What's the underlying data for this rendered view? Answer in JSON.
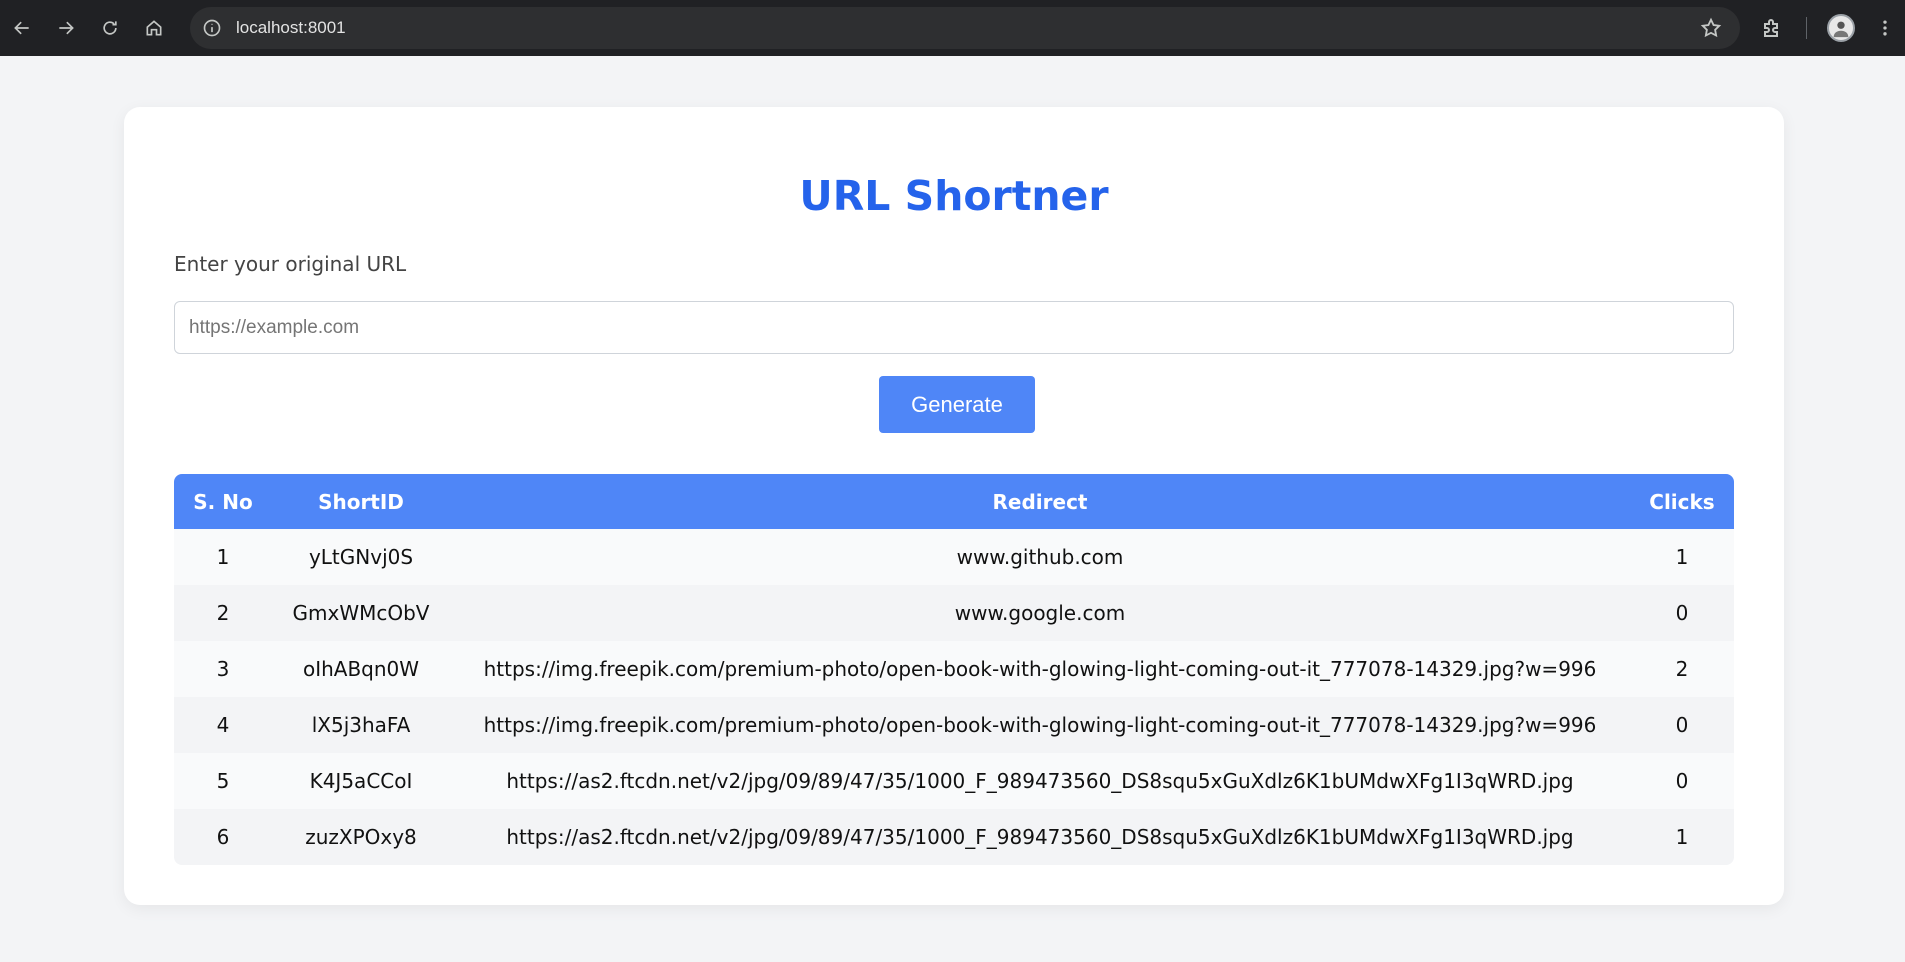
{
  "browser": {
    "url": "localhost:8001"
  },
  "app": {
    "title": "URL Shortner",
    "input_label": "Enter your original URL",
    "input_placeholder": "https://example.com",
    "input_value": "",
    "generate_label": "Generate",
    "accent_color": "#2563eb",
    "button_color": "#4f86f7"
  },
  "table": {
    "headers": [
      "S. No",
      "ShortID",
      "Redirect",
      "Clicks"
    ],
    "rows": [
      {
        "sno": "1",
        "shortid": "yLtGNvj0S",
        "redirect": "www.github.com",
        "clicks": "1"
      },
      {
        "sno": "2",
        "shortid": "GmxWMcObV",
        "redirect": "www.google.com",
        "clicks": "0"
      },
      {
        "sno": "3",
        "shortid": "oIhABqn0W",
        "redirect": "https://img.freepik.com/premium-photo/open-book-with-glowing-light-coming-out-it_777078-14329.jpg?w=996",
        "clicks": "2"
      },
      {
        "sno": "4",
        "shortid": "lX5j3haFA",
        "redirect": "https://img.freepik.com/premium-photo/open-book-with-glowing-light-coming-out-it_777078-14329.jpg?w=996",
        "clicks": "0"
      },
      {
        "sno": "5",
        "shortid": "K4J5aCCoI",
        "redirect": "https://as2.ftcdn.net/v2/jpg/09/89/47/35/1000_F_989473560_DS8squ5xGuXdlz6K1bUMdwXFg1I3qWRD.jpg",
        "clicks": "0"
      },
      {
        "sno": "6",
        "shortid": "zuzXPOxy8",
        "redirect": "https://as2.ftcdn.net/v2/jpg/09/89/47/35/1000_F_989473560_DS8squ5xGuXdlz6K1bUMdwXFg1I3qWRD.jpg",
        "clicks": "1"
      }
    ]
  }
}
